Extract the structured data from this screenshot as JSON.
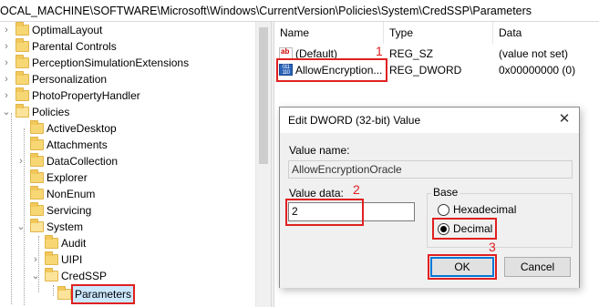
{
  "address": {
    "path": "OCAL_MACHINE\\SOFTWARE\\Microsoft\\Windows\\CurrentVersion\\Policies\\System\\CredSSP\\Parameters"
  },
  "tree": {
    "items": [
      {
        "label": "OptimalLayout"
      },
      {
        "label": "Parental Controls"
      },
      {
        "label": "PerceptionSimulationExtensions"
      },
      {
        "label": "Personalization"
      },
      {
        "label": "PhotoPropertyHandler"
      },
      {
        "label": "Policies"
      },
      {
        "label": "ActiveDesktop"
      },
      {
        "label": "Attachments"
      },
      {
        "label": "DataCollection"
      },
      {
        "label": "Explorer"
      },
      {
        "label": "NonEnum"
      },
      {
        "label": "Servicing"
      },
      {
        "label": "System"
      },
      {
        "label": "Audit"
      },
      {
        "label": "UIPI"
      },
      {
        "label": "CredSSP"
      },
      {
        "label": "Parameters"
      }
    ]
  },
  "values_pane": {
    "headers": {
      "name": "Name",
      "type": "Type",
      "data": "Data"
    },
    "rows": [
      {
        "name": "(Default)",
        "type": "REG_SZ",
        "data": "(value not set)",
        "icon": "string-value-icon"
      },
      {
        "name": "AllowEncryption...",
        "type": "REG_DWORD",
        "data": "0x00000000 (0)",
        "icon": "binary-value-icon"
      }
    ]
  },
  "dialog": {
    "title": "Edit DWORD (32-bit) Value",
    "value_name_label": "Value name:",
    "value_name": "AllowEncryptionOracle",
    "value_data_label": "Value data:",
    "value_data": "2",
    "base_label": "Base",
    "base_options": [
      {
        "label": "Hexadecimal",
        "checked": false
      },
      {
        "label": "Decimal",
        "checked": true
      }
    ],
    "ok_label": "OK",
    "cancel_label": "Cancel"
  },
  "annotations": {
    "n1": "1",
    "n2": "2",
    "n3": "3"
  },
  "colors": {
    "highlight": "#e02020",
    "selection": "#cce8ff",
    "folder": "#f7d774"
  }
}
